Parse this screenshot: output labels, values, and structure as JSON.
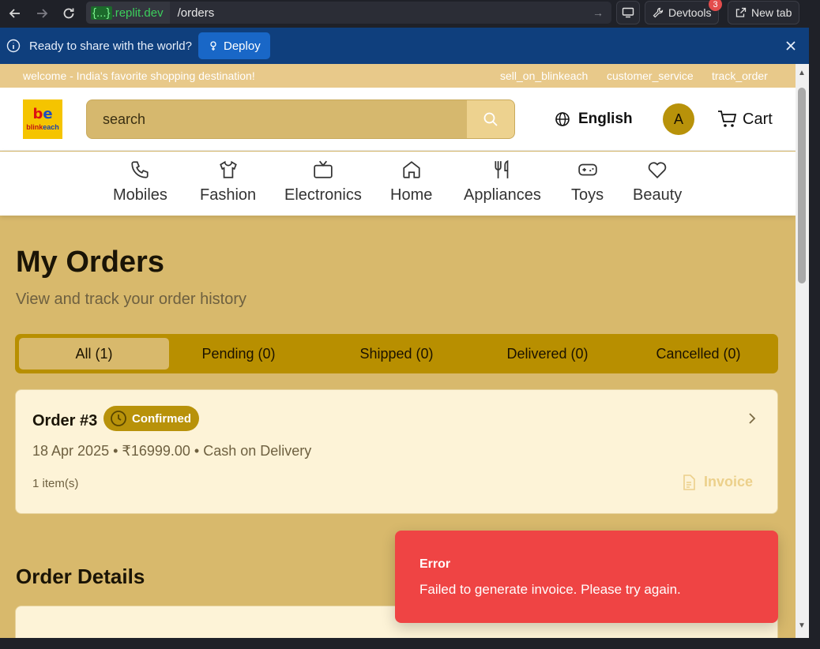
{
  "browser": {
    "url_domain_brace": "{...}",
    "url_domain": ".replit.dev",
    "url_path": "/orders",
    "devtools_label": "Devtools",
    "devtools_badge": "3",
    "newtab_label": "New tab"
  },
  "deploy_bar": {
    "message": "Ready to share with the world?",
    "deploy_label": "Deploy"
  },
  "topstrip": {
    "welcome": "welcome - India's favorite shopping destination!",
    "links": [
      "sell_on_blinkeach",
      "customer_service",
      "track_order"
    ]
  },
  "header": {
    "logo_text_red": "blink",
    "logo_text_blue": "each",
    "search_placeholder": "search",
    "language": "English",
    "avatar_initial": "A",
    "cart_label": "Cart"
  },
  "categories": [
    {
      "label": "Mobiles",
      "icon": "phone-icon"
    },
    {
      "label": "Fashion",
      "icon": "shirt-icon"
    },
    {
      "label": "Electronics",
      "icon": "tv-icon"
    },
    {
      "label": "Home",
      "icon": "home-icon"
    },
    {
      "label": "Appliances",
      "icon": "utensils-icon"
    },
    {
      "label": "Toys",
      "icon": "gamepad-icon"
    },
    {
      "label": "Beauty",
      "icon": "heart-icon"
    }
  ],
  "main": {
    "title": "My Orders",
    "subtitle": "View and track your order history",
    "tabs": [
      {
        "label": "All (1)",
        "active": true
      },
      {
        "label": "Pending (0)",
        "active": false
      },
      {
        "label": "Shipped (0)",
        "active": false
      },
      {
        "label": "Delivered (0)",
        "active": false
      },
      {
        "label": "Cancelled (0)",
        "active": false
      }
    ]
  },
  "order": {
    "title": "Order #3",
    "status": "Confirmed",
    "meta": "18 Apr 2025 • ₹16999.00 • Cash on Delivery",
    "items": "1 item(s)",
    "invoice_label": "Invoice"
  },
  "details": {
    "title": "Order Details"
  },
  "toast": {
    "title": "Error",
    "message": "Failed to generate invoice. Please try again."
  },
  "colors": {
    "accent": "#b8920a",
    "page_bg": "#d8b96c",
    "toast_bg": "#ef4444",
    "deploy_bar": "#0f3f7d"
  }
}
